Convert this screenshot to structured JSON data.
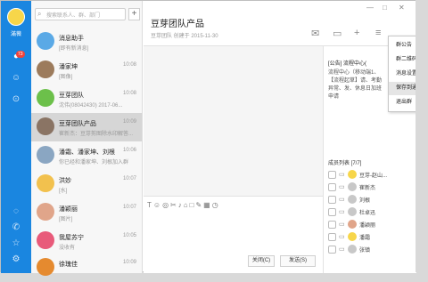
{
  "sidebar": {
    "user_name": "滿薇",
    "unread_badge": "73",
    "nav_icons": [
      "chat-icon",
      "contacts-icon",
      "apps-icon"
    ],
    "bottom_icons": [
      "headset-icon",
      "phone-icon",
      "star-icon",
      "settings-icon"
    ]
  },
  "search": {
    "placeholder": "搜索联系人、群、部门",
    "add_label": "+"
  },
  "conversations": [
    {
      "name": "消息助手",
      "preview": "[即有新消息]",
      "time": "",
      "color": "#5aa9e6"
    },
    {
      "name": "潘家坤",
      "preview": "[图像]",
      "time": "10:08",
      "color": "#9c7b5c"
    },
    {
      "name": "豆芽团队",
      "preview": "沈伟(08042430) 2017-06...",
      "time": "10:08",
      "color": "#6cc04a"
    },
    {
      "name": "豆芽团队产品",
      "preview": "崔新杰：豆芽剪图除水印解答...",
      "time": "10:09",
      "color": "#8a7464"
    },
    {
      "name": "潘霜、潘家坤、刘根",
      "preview": "你已经和潘家坤、刘根加入群",
      "time": "10:06",
      "color": "#8aa6c2"
    },
    {
      "name": "洪妙",
      "preview": "[水]",
      "time": "10:07",
      "color": "#f2c14e"
    },
    {
      "name": "潘颖丽",
      "preview": "[图片]",
      "time": "10:07",
      "color": "#e0a58a"
    },
    {
      "name": "我屋苏宁",
      "preview": "没收有",
      "time": "10:05",
      "color": "#e85a7a"
    },
    {
      "name": "徐瑰佳",
      "preview": "",
      "time": "10:09",
      "color": "#e58a2f"
    }
  ],
  "group": {
    "title": "豆芽团队产品",
    "created": "豆芽团队 创建于 2015-11-30"
  },
  "toolbar_icons": [
    "mail-icon",
    "folder-icon",
    "add-icon",
    "menu-icon"
  ],
  "window_controls": [
    "minimize-icon",
    "maximize-icon",
    "close-icon"
  ],
  "notice": {
    "header": "[公告] 流程中心(",
    "text": "流程中心（移动端1、【流程起草】请、考勤异常、发、休息日加班申请"
  },
  "members": {
    "header": "成员列表 [7/7]",
    "list": [
      {
        "name": "豆芽-赵山...",
        "color": "#f7d64a"
      },
      {
        "name": "崔新杰",
        "color": "#c8c8c8"
      },
      {
        "name": "刘根",
        "color": "#c8c8c8"
      },
      {
        "name": "杜卓迅",
        "color": "#c8c8c8"
      },
      {
        "name": "潘颖丽",
        "color": "#e0a58a"
      },
      {
        "name": "潘霜",
        "color": "#f7d64a"
      },
      {
        "name": "张镇",
        "color": "#c8c8c8"
      }
    ]
  },
  "context_menu": {
    "items": [
      "群公告",
      "群二维码",
      "消息设置",
      "保存到通讯录",
      "退出群"
    ],
    "highlighted_index": 3
  },
  "input_tools": [
    "T",
    "☺",
    "◎",
    "✂",
    "♪",
    "⌂",
    "□",
    "✎",
    "▦",
    "◷"
  ],
  "buttons": {
    "close": "关闭(C)",
    "send": "发送(S)"
  }
}
